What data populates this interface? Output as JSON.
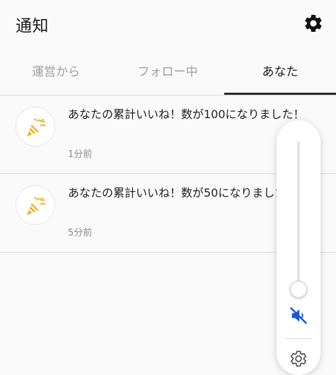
{
  "header": {
    "title": "通知",
    "settings_icon": "gear-icon"
  },
  "tabs": [
    {
      "label": "運営から",
      "active": false
    },
    {
      "label": "フォロー中",
      "active": false
    },
    {
      "label": "あなた",
      "active": true
    }
  ],
  "notifications": [
    {
      "icon": "party-popper-icon",
      "message": "あなたの累計いいね！数が100になりました！",
      "time": "1分前"
    },
    {
      "icon": "party-popper-icon",
      "message": "あなたの累計いいね！数が50になりました！",
      "time": "5分前"
    }
  ],
  "volume_panel": {
    "level": 0,
    "muted": true,
    "mute_icon": "volume-muted-icon",
    "settings_icon": "gear-icon",
    "colors": {
      "mute_icon": "#1a56db"
    }
  },
  "colors": {
    "active_tab": "#1a1a1a",
    "inactive_tab": "#9e9e9e",
    "popper": "#f0b429"
  }
}
